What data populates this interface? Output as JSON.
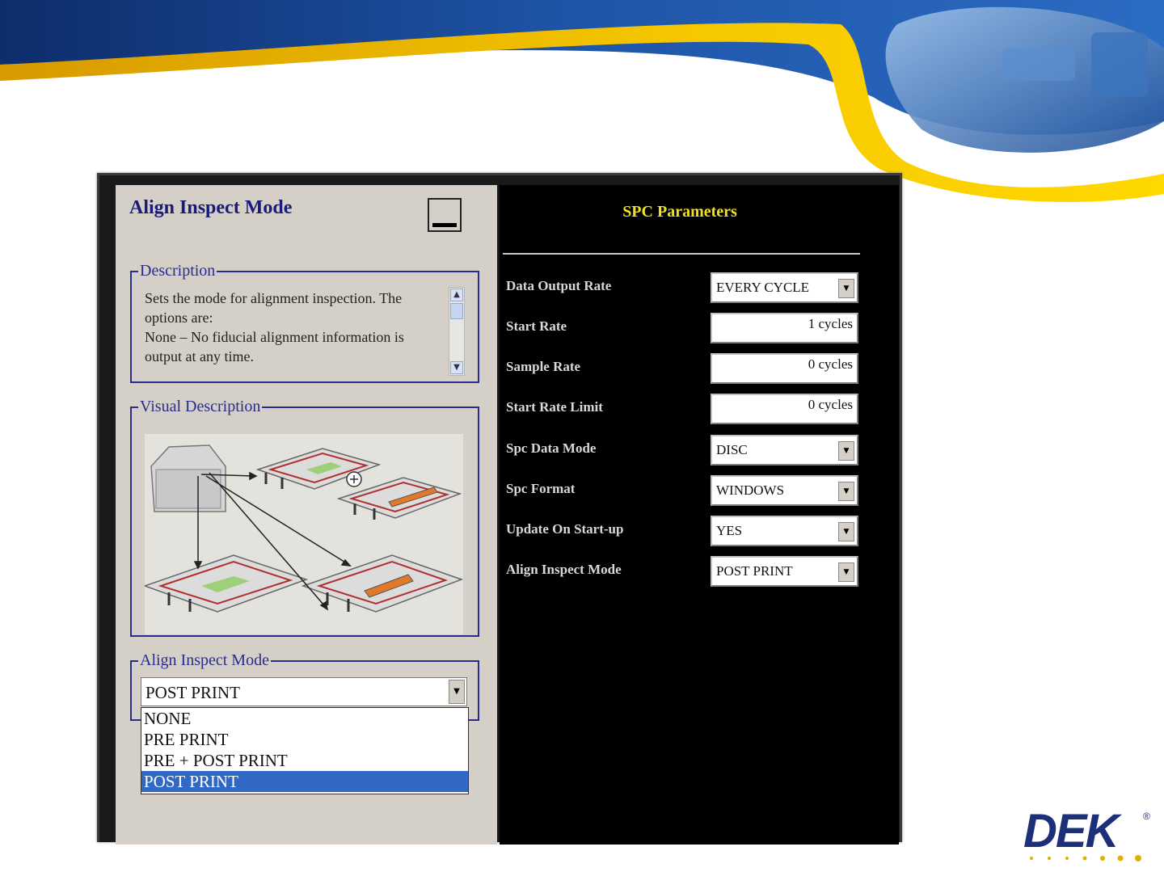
{
  "left_panel": {
    "title": "Align Inspect Mode",
    "description": {
      "legend": "Description",
      "lines": [
        "Sets the mode for alignment inspection.  The options are:",
        "None – No fiducial alignment information is output at any time."
      ]
    },
    "visual": {
      "legend": "Visual Description"
    },
    "mode": {
      "legend": "Align Inspect Mode",
      "selected": "POST PRINT",
      "options": [
        "NONE",
        "PRE PRINT",
        "PRE + POST PRINT",
        "POST PRINT"
      ]
    }
  },
  "right_panel": {
    "title": "SPC Parameters",
    "params": [
      {
        "label": "Data Output Rate",
        "value": "EVERY CYCLE",
        "type": "dropdown"
      },
      {
        "label": "Start Rate",
        "value": "1 cycles",
        "type": "text"
      },
      {
        "label": "Sample Rate",
        "value": "0 cycles",
        "type": "text"
      },
      {
        "label": "Start Rate Limit",
        "value": "0 cycles",
        "type": "text"
      },
      {
        "label": "Spc Data Mode",
        "value": "DISC",
        "type": "dropdown"
      },
      {
        "label": "Spc Format",
        "value": "WINDOWS",
        "type": "dropdown"
      },
      {
        "label": "Update On Start-up",
        "value": "YES",
        "type": "dropdown"
      },
      {
        "label": "Align Inspect Mode",
        "value": "POST PRINT",
        "type": "dropdown"
      }
    ]
  },
  "logo": {
    "text": "DEK",
    "registered": "®"
  },
  "colors": {
    "banner_blue": "#1f4f9c",
    "banner_yellow": "#f5c400",
    "selection": "#3168c4",
    "spc_title": "#f0e020"
  }
}
